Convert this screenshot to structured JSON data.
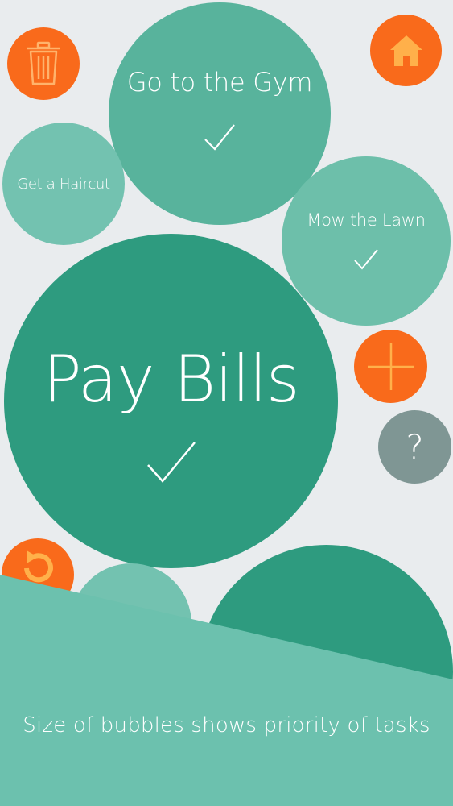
{
  "bubbles": {
    "gym": {
      "label": "Go to the Gym"
    },
    "haircut": {
      "label": "Get a Haircut"
    },
    "lawn": {
      "label": "Mow the Lawn"
    },
    "bills": {
      "label": "Pay Bills"
    }
  },
  "buttons": {
    "trash": {
      "icon": "trash-icon"
    },
    "home": {
      "icon": "home-icon"
    },
    "add": {
      "icon": "plus-icon"
    },
    "help": {
      "icon": "question-icon",
      "label": "?"
    },
    "undo": {
      "icon": "undo-icon"
    }
  },
  "banner": {
    "text": "Size of bubbles shows priority of  tasks"
  },
  "colors": {
    "background": "#e9ecee",
    "bubble_dark": "#2e9b7f",
    "bubble_mid": "#58b39c",
    "bubble_light": "#73c2b0",
    "orange": "#f96a1b",
    "gray_button": "#7f9694",
    "banner": "#6cc1ae"
  }
}
